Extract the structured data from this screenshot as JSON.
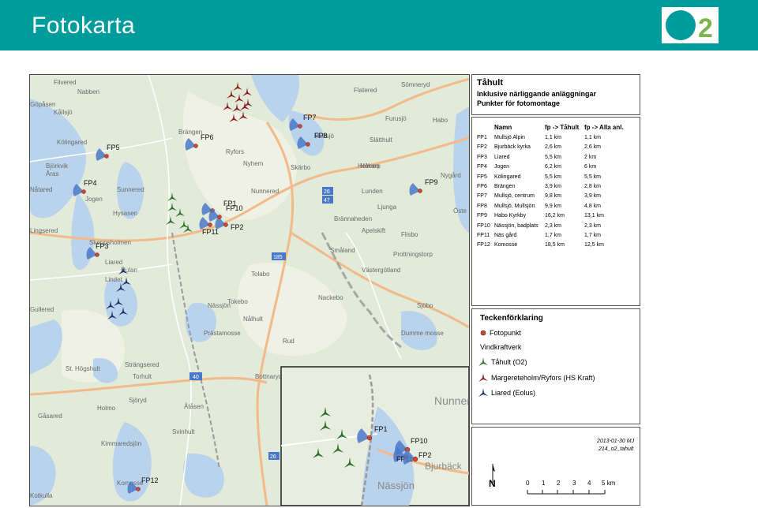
{
  "header": {
    "title": "Fotokarta",
    "logo_text": "O2"
  },
  "colors": {
    "header": "#009b9b",
    "logo_circle": "#009b9b",
    "logo_digit": "#7ab648",
    "fotopunkt": "#d9432a",
    "tahult": "#2a6e2a",
    "margereteholm": "#8b1d1d",
    "liared": "#1e2c66",
    "sector": "#4a78c8"
  },
  "info": {
    "title": "Tåhult",
    "line1": "Inklusive närliggande anläggningar",
    "line2": "Punkter för fotomontage"
  },
  "table": {
    "headers": [
      "Namn",
      "fp -> Tåhult",
      "fp -> Alla anl."
    ],
    "rows": [
      [
        "FP1",
        "Mullsjö Alpin",
        "1,1 km",
        "1,1 km"
      ],
      [
        "FP2",
        "Bjurbäck kyrka",
        "2,6 km",
        "2,6 km"
      ],
      [
        "FP3",
        "Liared",
        "5,5 km",
        "2 km"
      ],
      [
        "FP4",
        "Jogen",
        "6,2 km",
        "6 km"
      ],
      [
        "FP5",
        "Kölingared",
        "5,5 km",
        "5,5 km"
      ],
      [
        "FP6",
        "Brängen",
        "3,9 km",
        "2,8 km"
      ],
      [
        "FP7",
        "Mullsjö, centrum",
        "9,8 km",
        "3,9 km"
      ],
      [
        "FP8",
        "Mullsjö, Mullsjön",
        "9,9 km",
        "4,8 km"
      ],
      [
        "FP9",
        "Habo Kyrkby",
        "16,2 km",
        "13,1 km"
      ],
      [
        "FP10",
        "Nässjön, badplats",
        "2,3 km",
        "2,3 km"
      ],
      [
        "FP11",
        "Näs gård",
        "1,7 km",
        "1,7 km"
      ],
      [
        "FP12",
        "Komosse",
        "18,5 km",
        "12,5 km"
      ]
    ]
  },
  "legend": {
    "title": "Teckenförklaring",
    "fotopunkt": "Fotopunkt",
    "vindkraftverk": "Vindkraftverk",
    "tahult": "Tåhult (O2)",
    "margereteholm": "Margereteholm/Ryfors (HS Kraft)",
    "liared": "Liared (Eolus)"
  },
  "footer": {
    "date": "2013-01-30 MJ",
    "file": "214_o2_tahult",
    "north": "N",
    "scale_labels": [
      "0",
      "1",
      "2",
      "3",
      "4",
      "5 km"
    ]
  },
  "map": {
    "points": [
      {
        "id": "FP1",
        "label": "FP1"
      },
      {
        "id": "FP2",
        "label": "FP2"
      },
      {
        "id": "FP3",
        "label": "FP3"
      },
      {
        "id": "FP4",
        "label": "FP4"
      },
      {
        "id": "FP5",
        "label": "FP5"
      },
      {
        "id": "FP6",
        "label": "FP6"
      },
      {
        "id": "FP7",
        "label": "FP7"
      },
      {
        "id": "FP8",
        "label": "FP8"
      },
      {
        "id": "FP9",
        "label": "FP9"
      },
      {
        "id": "FP10",
        "label": "FP10"
      },
      {
        "id": "FP11",
        "label": "FP11"
      },
      {
        "id": "FP12",
        "label": "FP12"
      }
    ],
    "places": [
      "Filvered",
      "Nabben",
      "Göpåsen",
      "Kållsjö",
      "Kölingared",
      "Björkvik",
      "Åras",
      "Nåtared",
      "Jogen",
      "Hysasen",
      "Lingsered",
      "Skeppsholmen",
      "Liared",
      "Lindet",
      "Gullered",
      "Hulan",
      "Sunnered",
      "Brängen",
      "Ryfors",
      "Nyhem",
      "Nunnered",
      "Mullsjö",
      "Skärbo",
      "Hökarp",
      "Lunden",
      "Rud",
      "Tolabo",
      "Tokebo",
      "Nässjön",
      "Nålhult",
      "Prästamosse",
      "Torhult",
      "St. Högshult",
      "Strängsered",
      "Holmo",
      "Sjöryd",
      "Gåsared",
      "Kimmaredsjön",
      "Åtåsen",
      "Svinhult",
      "Komosse",
      "Kotkulla",
      "Furusjö",
      "Flatered",
      "Sömneryd",
      "Habo",
      "Slätthult",
      "Ljunga",
      "Holmen",
      "Nygård",
      "Öste",
      "Brännaheden",
      "Apelskift",
      "Flisbo",
      "Prottningstorp",
      "Nackebo",
      "Sjöbo",
      "Bottnaryd",
      "Dumme mosse",
      "Västergötland",
      "Småland",
      "Bjurbäck"
    ],
    "inset_places": [
      "Nunnered",
      "Nässjön",
      "Bjurbäck"
    ],
    "roads": [
      "26",
      "47",
      "185",
      "40",
      "26"
    ]
  }
}
